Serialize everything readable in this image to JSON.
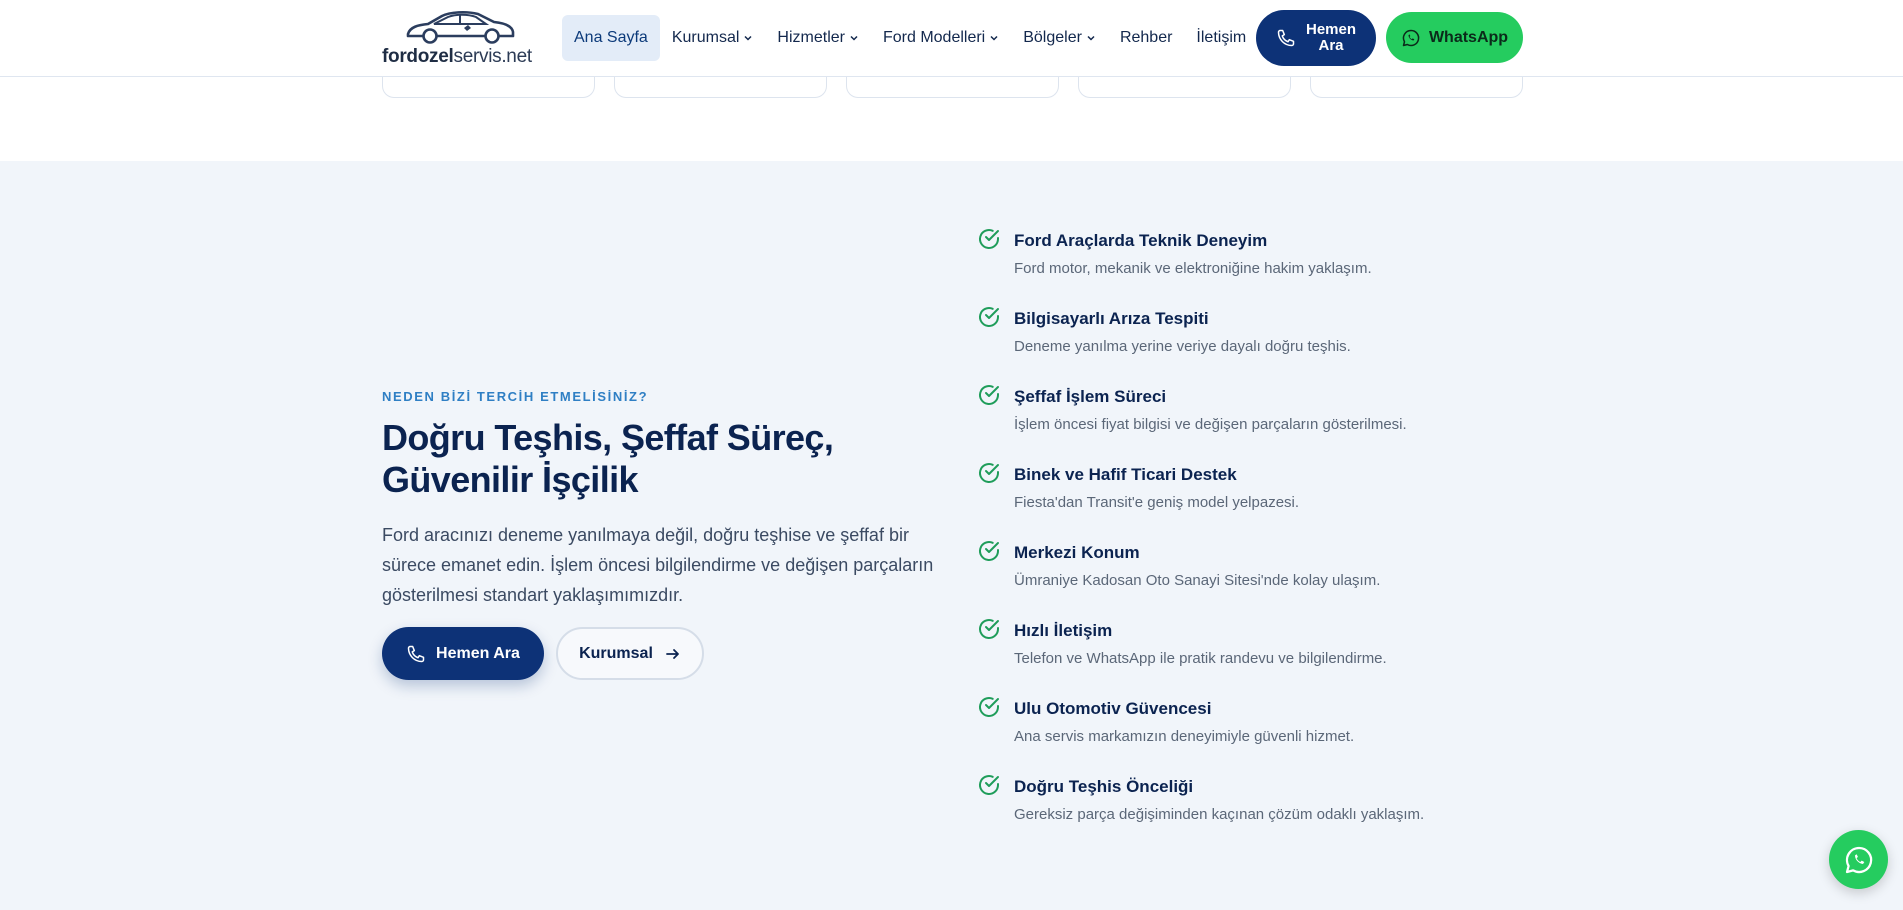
{
  "brand": {
    "name_bold": "fordozel",
    "name_light": "servis",
    "tld": ".net"
  },
  "nav": {
    "items": [
      {
        "label": "Ana Sayfa",
        "dropdown": false,
        "active": true
      },
      {
        "label": "Kurumsal",
        "dropdown": true,
        "active": false
      },
      {
        "label": "Hizmetler",
        "dropdown": true,
        "active": false
      },
      {
        "label": "Ford Modelleri",
        "dropdown": true,
        "active": false
      },
      {
        "label": "Bölgeler",
        "dropdown": true,
        "active": false
      },
      {
        "label": "Rehber",
        "dropdown": false,
        "active": false
      },
      {
        "label": "İletişim",
        "dropdown": false,
        "active": false
      }
    ],
    "call_label_line1": "Hemen",
    "call_label_line2": "Ara",
    "whatsapp_label": "WhatsApp"
  },
  "why": {
    "eyebrow": "NEDEN BİZİ TERCİH ETMELİSİNİZ?",
    "title": "Doğru Teşhis, Şeffaf Süreç, Güvenilir İşçilik",
    "lead": "Ford aracınızı deneme yanılmaya değil, doğru teşhise ve şeffaf bir sürece emanet edin. İşlem öncesi bilgilendirme ve değişen parçaların gösterilmesi standart yaklaşımımızdır.",
    "call_button": "Hemen Ara",
    "kurumsal_button": "Kurumsal",
    "features": [
      {
        "title": "Ford Araçlarda Teknik Deneyim",
        "desc": "Ford motor, mekanik ve elektroniğine hakim yaklaşım."
      },
      {
        "title": "Bilgisayarlı Arıza Tespiti",
        "desc": "Deneme yanılma yerine veriye dayalı doğru teşhis."
      },
      {
        "title": "Şeffaf İşlem Süreci",
        "desc": "İşlem öncesi fiyat bilgisi ve değişen parçaların gösterilmesi."
      },
      {
        "title": "Binek ve Hafif Ticari Destek",
        "desc": "Fiesta'dan Transit'e geniş model yelpazesi."
      },
      {
        "title": "Merkezi Konum",
        "desc": "Ümraniye Kadosan Oto Sanayi Sitesi'nde kolay ulaşım."
      },
      {
        "title": "Hızlı İletişim",
        "desc": "Telefon ve WhatsApp ile pratik randevu ve bilgilendirme."
      },
      {
        "title": "Ulu Otomotiv Güvencesi",
        "desc": "Ana servis markamızın deneyimiyle güvenli hizmet."
      },
      {
        "title": "Doğru Teşhis Önceliği",
        "desc": "Gereksiz parça değişiminden kaçınan çözüm odaklı yaklaşım."
      }
    ]
  },
  "colors": {
    "navy": "#0d3277",
    "accent_blue": "#2f7fc4",
    "whatsapp_green": "#25cc5f",
    "section_bg": "#f1f5fa",
    "check_green": "#1f9d5a"
  }
}
